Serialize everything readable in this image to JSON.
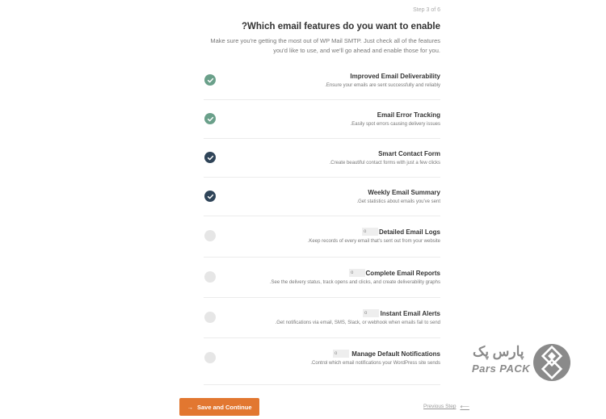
{
  "header": {
    "step": "Step 3 of 6",
    "title": "?Which email features do you want to enable",
    "subtitle_line1": "Make sure you're getting the most out of WP Mail SMTP. Just check all of the features",
    "subtitle_line2": ".you'd like to use, and we'll go ahead and enable those for you"
  },
  "features": [
    {
      "name": "Improved Email Deliverability",
      "desc": ".Ensure your emails are sent successfully and reliably",
      "checked": true,
      "color": "#6aa08a"
    },
    {
      "name": "Email Error Tracking",
      "desc": ".Easily spot errors causing delivery issues",
      "checked": true,
      "color": "#6aa08a"
    },
    {
      "name": "Smart Contact Form",
      "desc": ".Create beautiful contact forms with just a few clicks",
      "checked": true,
      "color": "#2f4458"
    },
    {
      "name": "Weekly Email Summary",
      "desc": ".Get statistics about emails you've sent",
      "checked": true,
      "color": "#2f4458"
    },
    {
      "name": "Detailed Email Logs",
      "desc": ".Keep records of every email that's sent out from your website",
      "checked": false,
      "pro": "o"
    },
    {
      "name": "Complete Email Reports",
      "desc": ".See the delivery status, track opens and clicks, and create deliverability graphs",
      "checked": false,
      "pro": "o"
    },
    {
      "name": "Instant Email Alerts",
      "desc": ".Get notifications via email, SMS, Slack, or webhook when emails fail to send",
      "checked": false,
      "pro": "o"
    },
    {
      "name": "Manage Default Notifications",
      "desc": ".Control which email notifications your WordPress site sends",
      "checked": false,
      "pro": "o"
    }
  ],
  "footer": {
    "save_label": "Save and Continue",
    "save_icon": "→",
    "prev_label": "Previous Step",
    "prev_icon": "⟵"
  },
  "logo": {
    "fa_text": "پارس پک",
    "en_text": "Pars PACK"
  },
  "colors": {
    "accent": "#e27730",
    "check_green": "#6aa08a",
    "check_navy": "#2f4458"
  }
}
